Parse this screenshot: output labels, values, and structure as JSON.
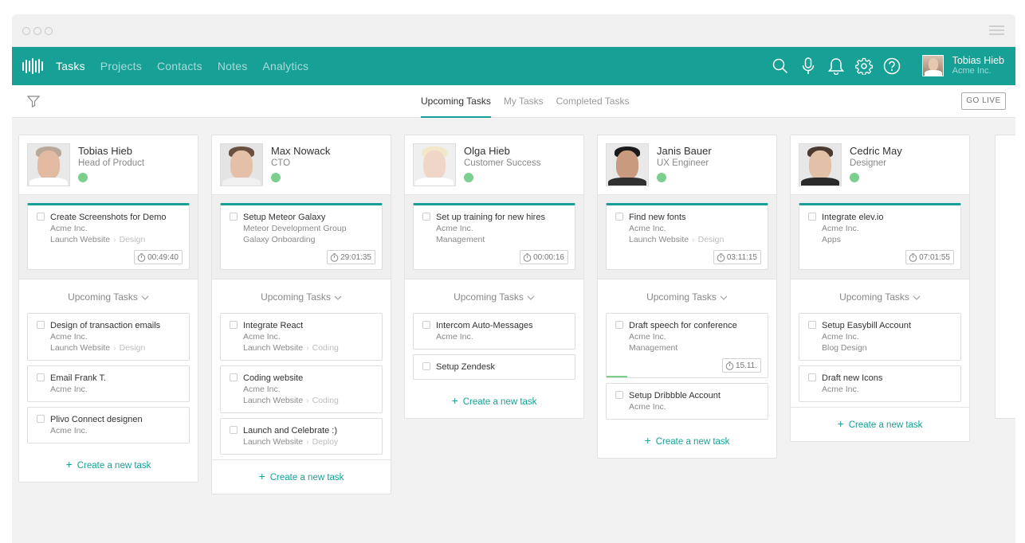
{
  "nav": {
    "items": [
      {
        "label": "Tasks",
        "active": true
      },
      {
        "label": "Projects",
        "active": false
      },
      {
        "label": "Contacts",
        "active": false
      },
      {
        "label": "Notes",
        "active": false
      },
      {
        "label": "Analytics",
        "active": false
      }
    ]
  },
  "user": {
    "name": "Tobias Hieb",
    "company": "Acme Inc."
  },
  "icons": [
    "search-icon",
    "microphone-icon",
    "bell-icon",
    "gear-icon",
    "help-icon"
  ],
  "tabs": [
    {
      "label": "Upcoming Tasks",
      "active": true
    },
    {
      "label": "My Tasks",
      "active": false
    },
    {
      "label": "Completed Tasks",
      "active": false
    }
  ],
  "go_live": "GO LIVE",
  "colors": {
    "accent": "#16a096",
    "status_online": "#7dcf8f"
  },
  "upcoming_label": "Upcoming Tasks",
  "create_label": "Create a new task",
  "columns": [
    {
      "name": "Tobias Hieb",
      "role": "Head of Product",
      "current": {
        "title": "Create Screenshots for Demo",
        "company": "Acme Inc.",
        "project": "Launch Website",
        "tag": "Design",
        "timer": "00:49:40"
      },
      "upcoming": [
        {
          "title": "Design of transaction emails",
          "company": "Acme Inc.",
          "project": "Launch Website",
          "tag": "Design"
        },
        {
          "title": "Email Frank T.",
          "company": "Acme Inc."
        },
        {
          "title": "Plivo Connect designen",
          "company": "Acme Inc."
        }
      ]
    },
    {
      "name": "Max Nowack",
      "role": "CTO",
      "current": {
        "title": "Setup Meteor Galaxy",
        "company": "Meteor Development Group",
        "project": "Galaxy Onboarding",
        "timer": "29:01:35"
      },
      "upcoming": [
        {
          "title": "Integrate React",
          "company": "Acme Inc.",
          "project": "Launch Website",
          "tag": "Coding"
        },
        {
          "title": "Coding website",
          "company": "Acme Inc.",
          "project": "Launch Website",
          "tag": "Coding"
        },
        {
          "title": "Launch and Celebrate :)",
          "project": "Launch Website",
          "tag": "Deploy"
        }
      ]
    },
    {
      "name": "Olga Hieb",
      "role": "Customer Success",
      "current": {
        "title": "Set up training for new hires",
        "company": "Acme Inc.",
        "project": "Management",
        "timer": "00:00:16"
      },
      "upcoming": [
        {
          "title": "Intercom Auto-Messages",
          "company": "Acme Inc."
        },
        {
          "title": "Setup Zendesk"
        }
      ]
    },
    {
      "name": "Janis Bauer",
      "role": "UX Engineer",
      "current": {
        "title": "Find new fonts",
        "company": "Acme Inc.",
        "project": "Launch Website",
        "tag": "Design",
        "timer": "03:11:15"
      },
      "upcoming": [
        {
          "title": "Draft speech for conference",
          "company": "Acme Inc.",
          "project": "Management",
          "timer": "15.11.",
          "progress": 0.13
        },
        {
          "title": "Setup Dribbble Account",
          "company": "Acme Inc."
        }
      ]
    },
    {
      "name": "Cedric May",
      "role": "Designer",
      "current": {
        "title": "Integrate elev.io",
        "company": "Acme Inc.",
        "project": "Apps",
        "timer": "07:01:55"
      },
      "upcoming": [
        {
          "title": "Setup Easybill Account",
          "company": "Acme Inc.",
          "project": "Blog Design"
        },
        {
          "title": "Draft new Icons",
          "company": "Acme Inc."
        }
      ]
    }
  ]
}
